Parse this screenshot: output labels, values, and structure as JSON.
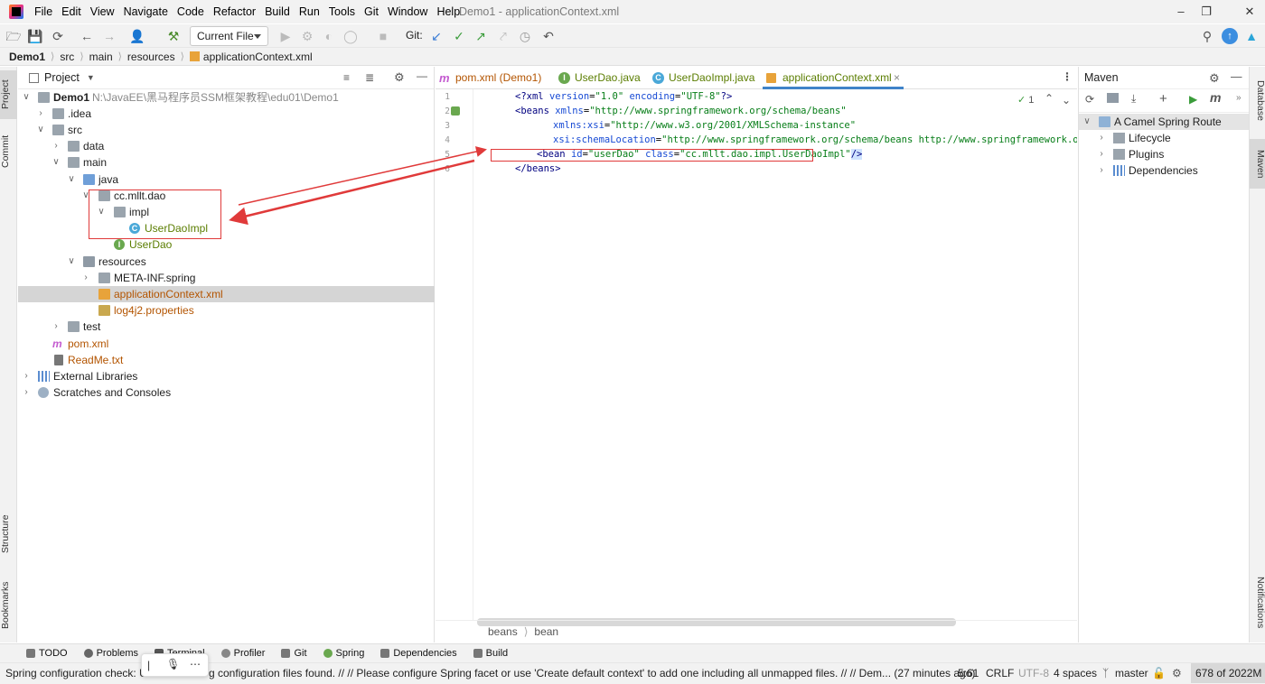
{
  "menubar": {
    "items": [
      "File",
      "Edit",
      "View",
      "Navigate",
      "Code",
      "Refactor",
      "Build",
      "Run",
      "Tools",
      "Git",
      "Window",
      "Help"
    ],
    "title": "Demo1 - applicationContext.xml"
  },
  "toolbar": {
    "run_config": "Current File",
    "git_label": "Git:"
  },
  "breadcrumbs": [
    "Demo1",
    "src",
    "main",
    "resources",
    "applicationContext.xml"
  ],
  "left_strip": {
    "project": "Project",
    "commit": "Commit",
    "structure": "Structure",
    "bookmarks": "Bookmarks"
  },
  "project": {
    "title": "Project",
    "root_path": "N:\\JavaEE\\黑马程序员SSM框架教程\\edu01\\Demo1",
    "tree": {
      "root": "Demo1",
      "idea": ".idea",
      "src": "src",
      "data": "data",
      "main": "main",
      "java": "java",
      "pkg": "cc.mllt.dao",
      "impl": "impl",
      "userdaoimpl": "UserDaoImpl",
      "userdao": "UserDao",
      "resources": "resources",
      "metainf": "META-INF.spring",
      "appctx": "applicationContext.xml",
      "log4j": "log4j2.properties",
      "test": "test",
      "pom": "pom.xml",
      "readme": "ReadMe.txt",
      "extlib": "External Libraries",
      "scratches": "Scratches and Consoles"
    }
  },
  "editor": {
    "tabs": [
      "pom.xml (Demo1)",
      "UserDao.java",
      "UserDaoImpl.java",
      "applicationContext.xml"
    ],
    "line_numbers": [
      "1",
      "2",
      "3",
      "4",
      "5",
      "6"
    ],
    "code": {
      "l1": {
        "a": "<?xml ",
        "b": "version",
        "c": "=",
        "d": "\"1.0\" ",
        "e": "encoding",
        "f": "=",
        "g": "\"UTF-8\"",
        "h": "?>"
      },
      "l2": {
        "a": "<beans ",
        "b": "xmlns",
        "c": "=",
        "d": "\"http://www.springframework.org/schema/beans\""
      },
      "l3": {
        "b": "xmlns:xsi",
        "c": "=",
        "d": "\"http://www.w3.org/2001/XMLSchema-instance\""
      },
      "l4": {
        "b": "xsi:schemaLocation",
        "c": "=",
        "d": "\"http://www.springframework.org/schema/beans http://www.springframework.org/schema/beans"
      },
      "l5": {
        "a": "<bean ",
        "b": "id",
        "c": "=",
        "d": "\"userDao\" ",
        "e": "class",
        "f": "=",
        "g": "\"cc.mllt.dao.impl.UserDaoImpl\"",
        "h": "/>"
      },
      "l6": {
        "a": "</beans>"
      }
    },
    "inspection_count": "1",
    "status_crumbs": [
      "beans",
      "bean"
    ]
  },
  "maven": {
    "title": "Maven",
    "root": "A Camel Spring Route",
    "items": [
      "Lifecycle",
      "Plugins",
      "Dependencies"
    ]
  },
  "right_strip": {
    "database": "Database",
    "maven": "Maven",
    "notifications": "Notifications"
  },
  "bottom_tools": [
    "TODO",
    "Problems",
    "Terminal",
    "Profiler",
    "Git",
    "Spring",
    "Dependencies",
    "Build"
  ],
  "status": {
    "msg_a": "Spring configuration check: Un",
    "msg_b": "g configuration files found. // // Please configure Spring facet or use 'Create default context' to add one including all unmapped files. // // Dem... (27 minutes ago)",
    "position": "5:61",
    "line_sep": "CRLF",
    "encoding": "UTF-8",
    "indent": "4 spaces",
    "branch": "master",
    "memory": "678 of 2022M"
  },
  "colors": {
    "annotation": "#e03a3a",
    "accent": "#4083c9",
    "selection": "#d5d5d5"
  }
}
